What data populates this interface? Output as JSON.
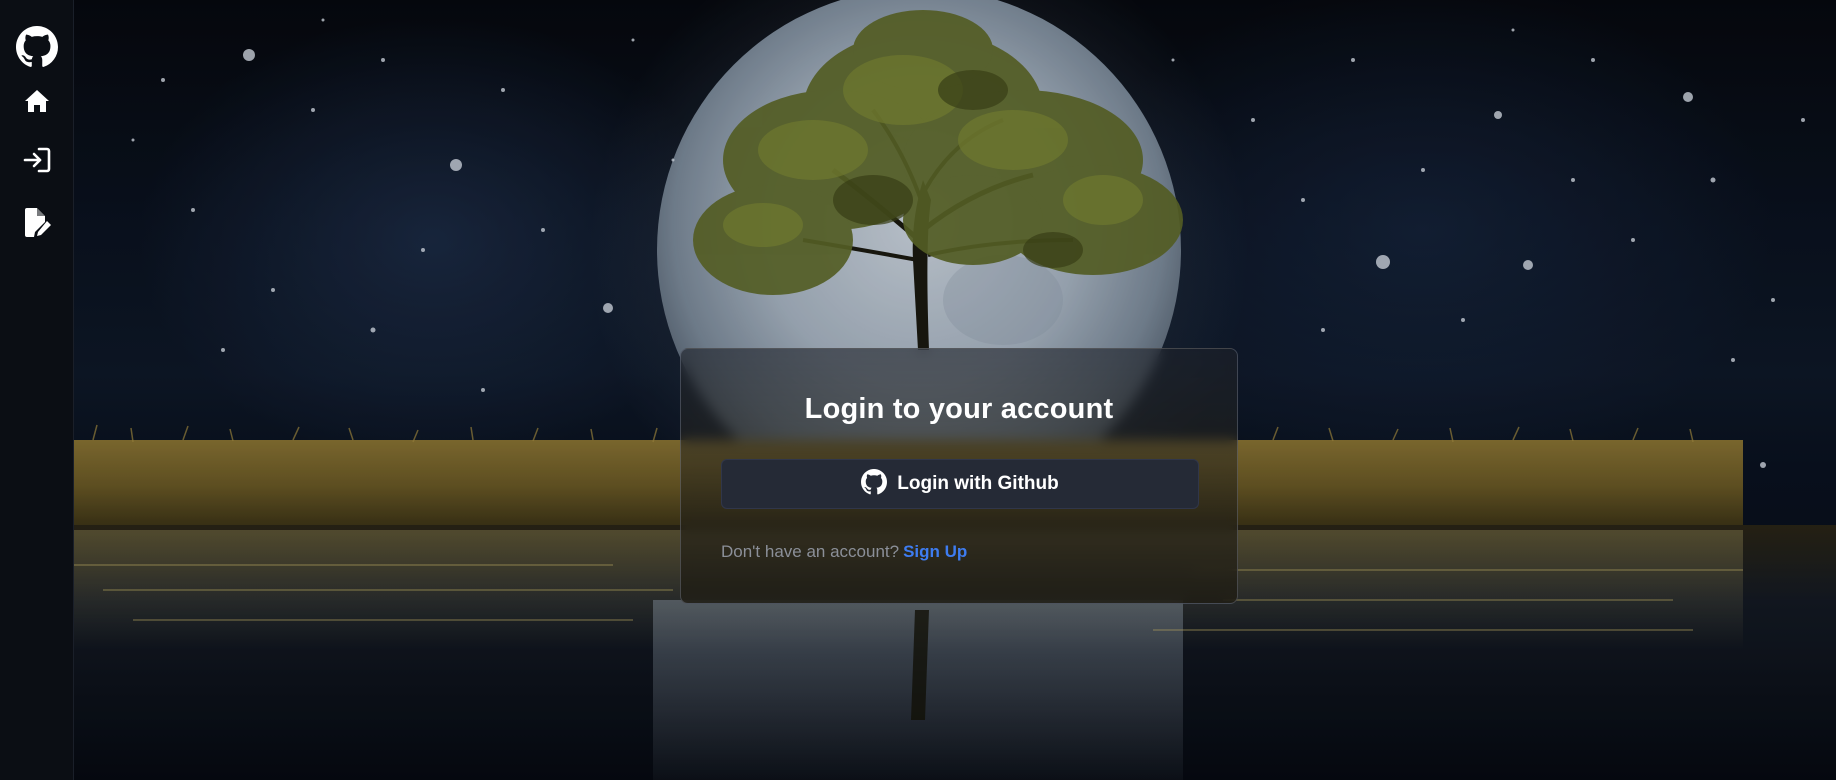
{
  "sidebar": {
    "items": [
      {
        "icon": "github-icon",
        "name": "GitHub"
      },
      {
        "icon": "home-icon",
        "name": "Home"
      },
      {
        "icon": "login-icon",
        "name": "Login"
      },
      {
        "icon": "signup-icon",
        "name": "Sign Up"
      }
    ]
  },
  "login": {
    "title": "Login to your account",
    "github_button_label": "Login with Github",
    "signup_prompt": "Don't have an account?",
    "signup_link": "Sign Up"
  },
  "colors": {
    "sidebar_bg": "#0b0e14",
    "button_bg": "#252a36",
    "link": "#3e7cf0",
    "title": "#ffffff",
    "muted_text": "#8b8f98"
  }
}
